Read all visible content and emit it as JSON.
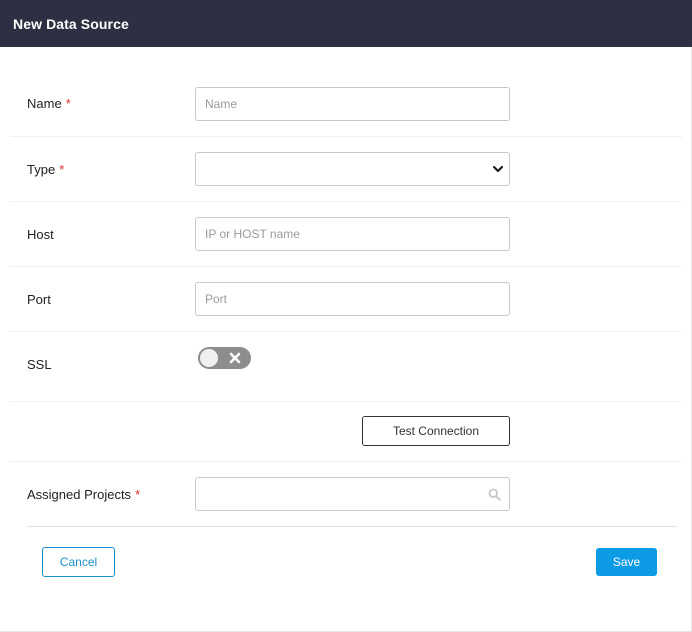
{
  "dialog": {
    "title": "New Data Source"
  },
  "form": {
    "required_marker": "*",
    "name": {
      "label": "Name",
      "placeholder": "Name",
      "value": ""
    },
    "type": {
      "label": "Type",
      "selected": ""
    },
    "host": {
      "label": "Host",
      "placeholder": "IP or HOST name",
      "value": ""
    },
    "port": {
      "label": "Port",
      "placeholder": "Port",
      "value": ""
    },
    "ssl": {
      "label": "SSL",
      "enabled": false
    },
    "test_connection_label": "Test Connection",
    "assigned_projects": {
      "label": "Assigned Projects",
      "value": ""
    }
  },
  "footer": {
    "cancel_label": "Cancel",
    "save_label": "Save"
  },
  "colors": {
    "header_bg": "#2d3042",
    "required": "#d9302c",
    "primary": "#0e9be5",
    "cancel_border": "#1a8fc8",
    "toggle_off": "#8d8d8d"
  },
  "icons": {
    "select_arrow": "chevron-down-icon",
    "toggle_off": "close-icon",
    "project_search": "search-icon"
  }
}
